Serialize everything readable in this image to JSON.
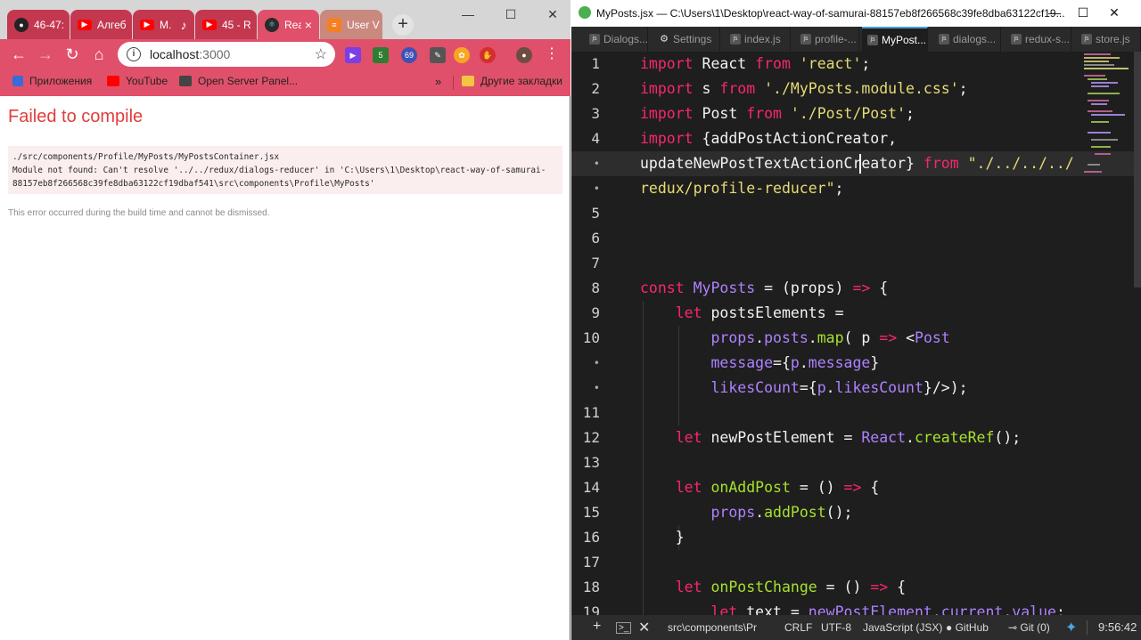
{
  "browser": {
    "tabs": [
      {
        "label": "46-47:",
        "icon": "github-icon"
      },
      {
        "label": "Алгеб",
        "icon": "youtube-icon"
      },
      {
        "label": "М.",
        "icon": "youtube-icon"
      },
      {
        "label": "45 - R",
        "icon": "youtube-icon"
      },
      {
        "label": "Rea",
        "icon": "react-icon"
      },
      {
        "label": "User V",
        "icon": "stackoverflow-icon"
      }
    ],
    "url_host": "localhost",
    "url_port": ":3000",
    "bookmarks": [
      "Приложения",
      "YouTube",
      "Open Server Panel...",
      "Другие закладки"
    ],
    "extension_badges": [
      "5",
      "69"
    ],
    "page": {
      "title": "Failed to compile",
      "error_lines": [
        "./src/components/Profile/MyPosts/MyPostsContainer.jsx",
        "Module not found: Can't resolve '../../redux/dialogs-reducer' in 'C:\\Users\\1\\Desktop\\react-way-of-samurai-",
        "88157eb8f266568c39fe8dba63122cf19dbaf541\\src\\components\\Profile\\MyPosts'"
      ],
      "note": "This error occurred during the build time and cannot be dismissed."
    },
    "accent": "#e0506a"
  },
  "editor": {
    "window_title": "MyPosts.jsx — C:\\Users\\1\\Desktop\\react-way-of-samurai-88157eb8f266568c39fe8dba63122cf19...",
    "tabs": [
      {
        "label": "Dialogs...",
        "icon": "js"
      },
      {
        "label": "Settings",
        "icon": "gear"
      },
      {
        "label": "index.js",
        "icon": "js"
      },
      {
        "label": "profile-...",
        "icon": "js"
      },
      {
        "label": "MyPost...",
        "icon": "js",
        "active": true
      },
      {
        "label": "dialogs...",
        "icon": "js"
      },
      {
        "label": "redux-s...",
        "icon": "js"
      },
      {
        "label": "store.js",
        "icon": "js"
      }
    ],
    "line_numbers": [
      "1",
      "2",
      "3",
      "4",
      "•",
      "•",
      "5",
      "6",
      "7",
      "8",
      "9",
      "10",
      "•",
      "•",
      "11",
      "12",
      "13",
      "14",
      "15",
      "16",
      "17",
      "18",
      "19"
    ],
    "status": {
      "path": "src\\components\\Pr",
      "eol": "CRLF",
      "encoding": "UTF-8",
      "language": "JavaScript (JSX)",
      "github": "GitHub",
      "git": "Git (0)",
      "time": "9:56:42"
    }
  }
}
